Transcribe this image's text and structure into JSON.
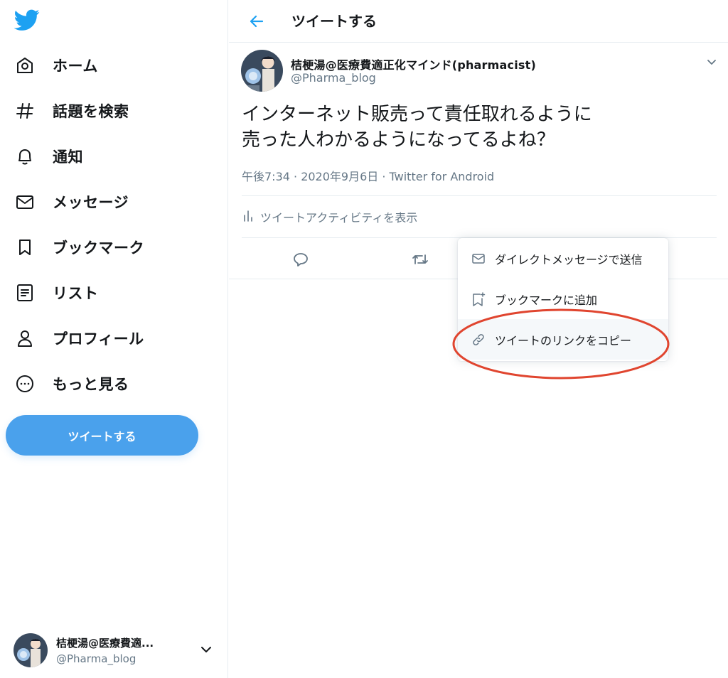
{
  "sidebar": {
    "logo_icon": "twitter-bird-icon",
    "items": [
      {
        "label": "ホーム",
        "icon": "home-icon"
      },
      {
        "label": "話題を検索",
        "icon": "hashtag-icon"
      },
      {
        "label": "通知",
        "icon": "bell-icon"
      },
      {
        "label": "メッセージ",
        "icon": "envelope-icon"
      },
      {
        "label": "ブックマーク",
        "icon": "bookmark-icon"
      },
      {
        "label": "リスト",
        "icon": "list-icon"
      },
      {
        "label": "プロフィール",
        "icon": "person-icon"
      },
      {
        "label": "もっと見る",
        "icon": "more-icon"
      }
    ],
    "tweet_button": "ツイートする",
    "account": {
      "display_name": "桔梗湯@医療費適...",
      "handle": "@Pharma_blog"
    }
  },
  "header": {
    "title": "ツイートする",
    "back_icon": "arrow-left-icon"
  },
  "tweet": {
    "display_name": "桔梗湯@医療費適正化マインド(pharmacist)",
    "handle": "@Pharma_blog",
    "text_lines": [
      "インターネット販売って責任取れるように",
      "売った人わかるようになってるよね？"
    ],
    "meta": "午後7:34 · 2020年9月6日 · Twitter for Android",
    "activity_label": "ツイートアクティビティを表示"
  },
  "menu": {
    "items": [
      {
        "label": "ダイレクトメッセージで送信",
        "icon": "envelope-icon"
      },
      {
        "label": "ブックマークに追加",
        "icon": "bookmark-add-icon"
      },
      {
        "label": "ツイートのリンクをコピー",
        "icon": "link-icon"
      }
    ]
  },
  "colors": {
    "accent": "#4aa1ec",
    "text_primary": "#14171a",
    "text_secondary": "#657786",
    "annotation": "#e0452f"
  }
}
